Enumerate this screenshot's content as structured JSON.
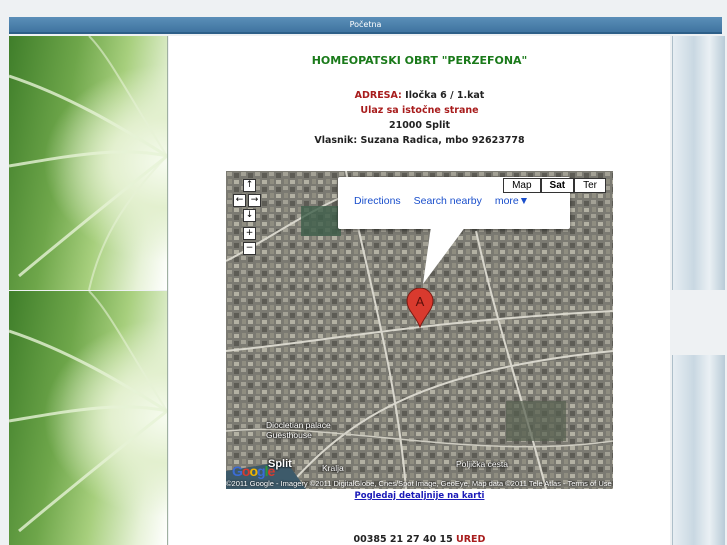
{
  "nav": {
    "home_label": "Početna"
  },
  "header": {
    "title": "HOMEOPATSKI OBRT \"PERZEFONA\""
  },
  "address": {
    "label": "ADRESA:",
    "street": "Iločka 6 / 1.kat",
    "entrance": "Ulaz sa istočne strane",
    "city": "21000 Split",
    "owner": "Vlasnik: Suzana Radica, mbo 92623778"
  },
  "map": {
    "types": [
      "Map",
      "Sat",
      "Ter"
    ],
    "active_type": "Sat",
    "info_links": [
      "Directions",
      "Search nearby",
      "more▼"
    ],
    "marker_label": "A",
    "place_labels": [
      "Diocletian palace",
      "Guesthouse",
      "Split",
      "Kralja",
      "Poljička cesta"
    ],
    "google_logo": "Google",
    "attribution": "©2011 Google - Imagery ©2011 DigitalGlobe, Cnes/Spot Image, GeoEye, Map data ©2011 Tele Atlas - Terms of Use",
    "colors": {
      "link": "#1a4fcc",
      "marker": "#d93a2e"
    }
  },
  "map_link": {
    "label": "Pogledaj detaljnije na karti"
  },
  "contact": {
    "phone": "00385 21 27 40 15",
    "phone_label": "URED"
  },
  "colors": {
    "title_green": "#1a7a1a",
    "accent_red": "#a81c1c",
    "nav_blue": "#4a80ab"
  }
}
